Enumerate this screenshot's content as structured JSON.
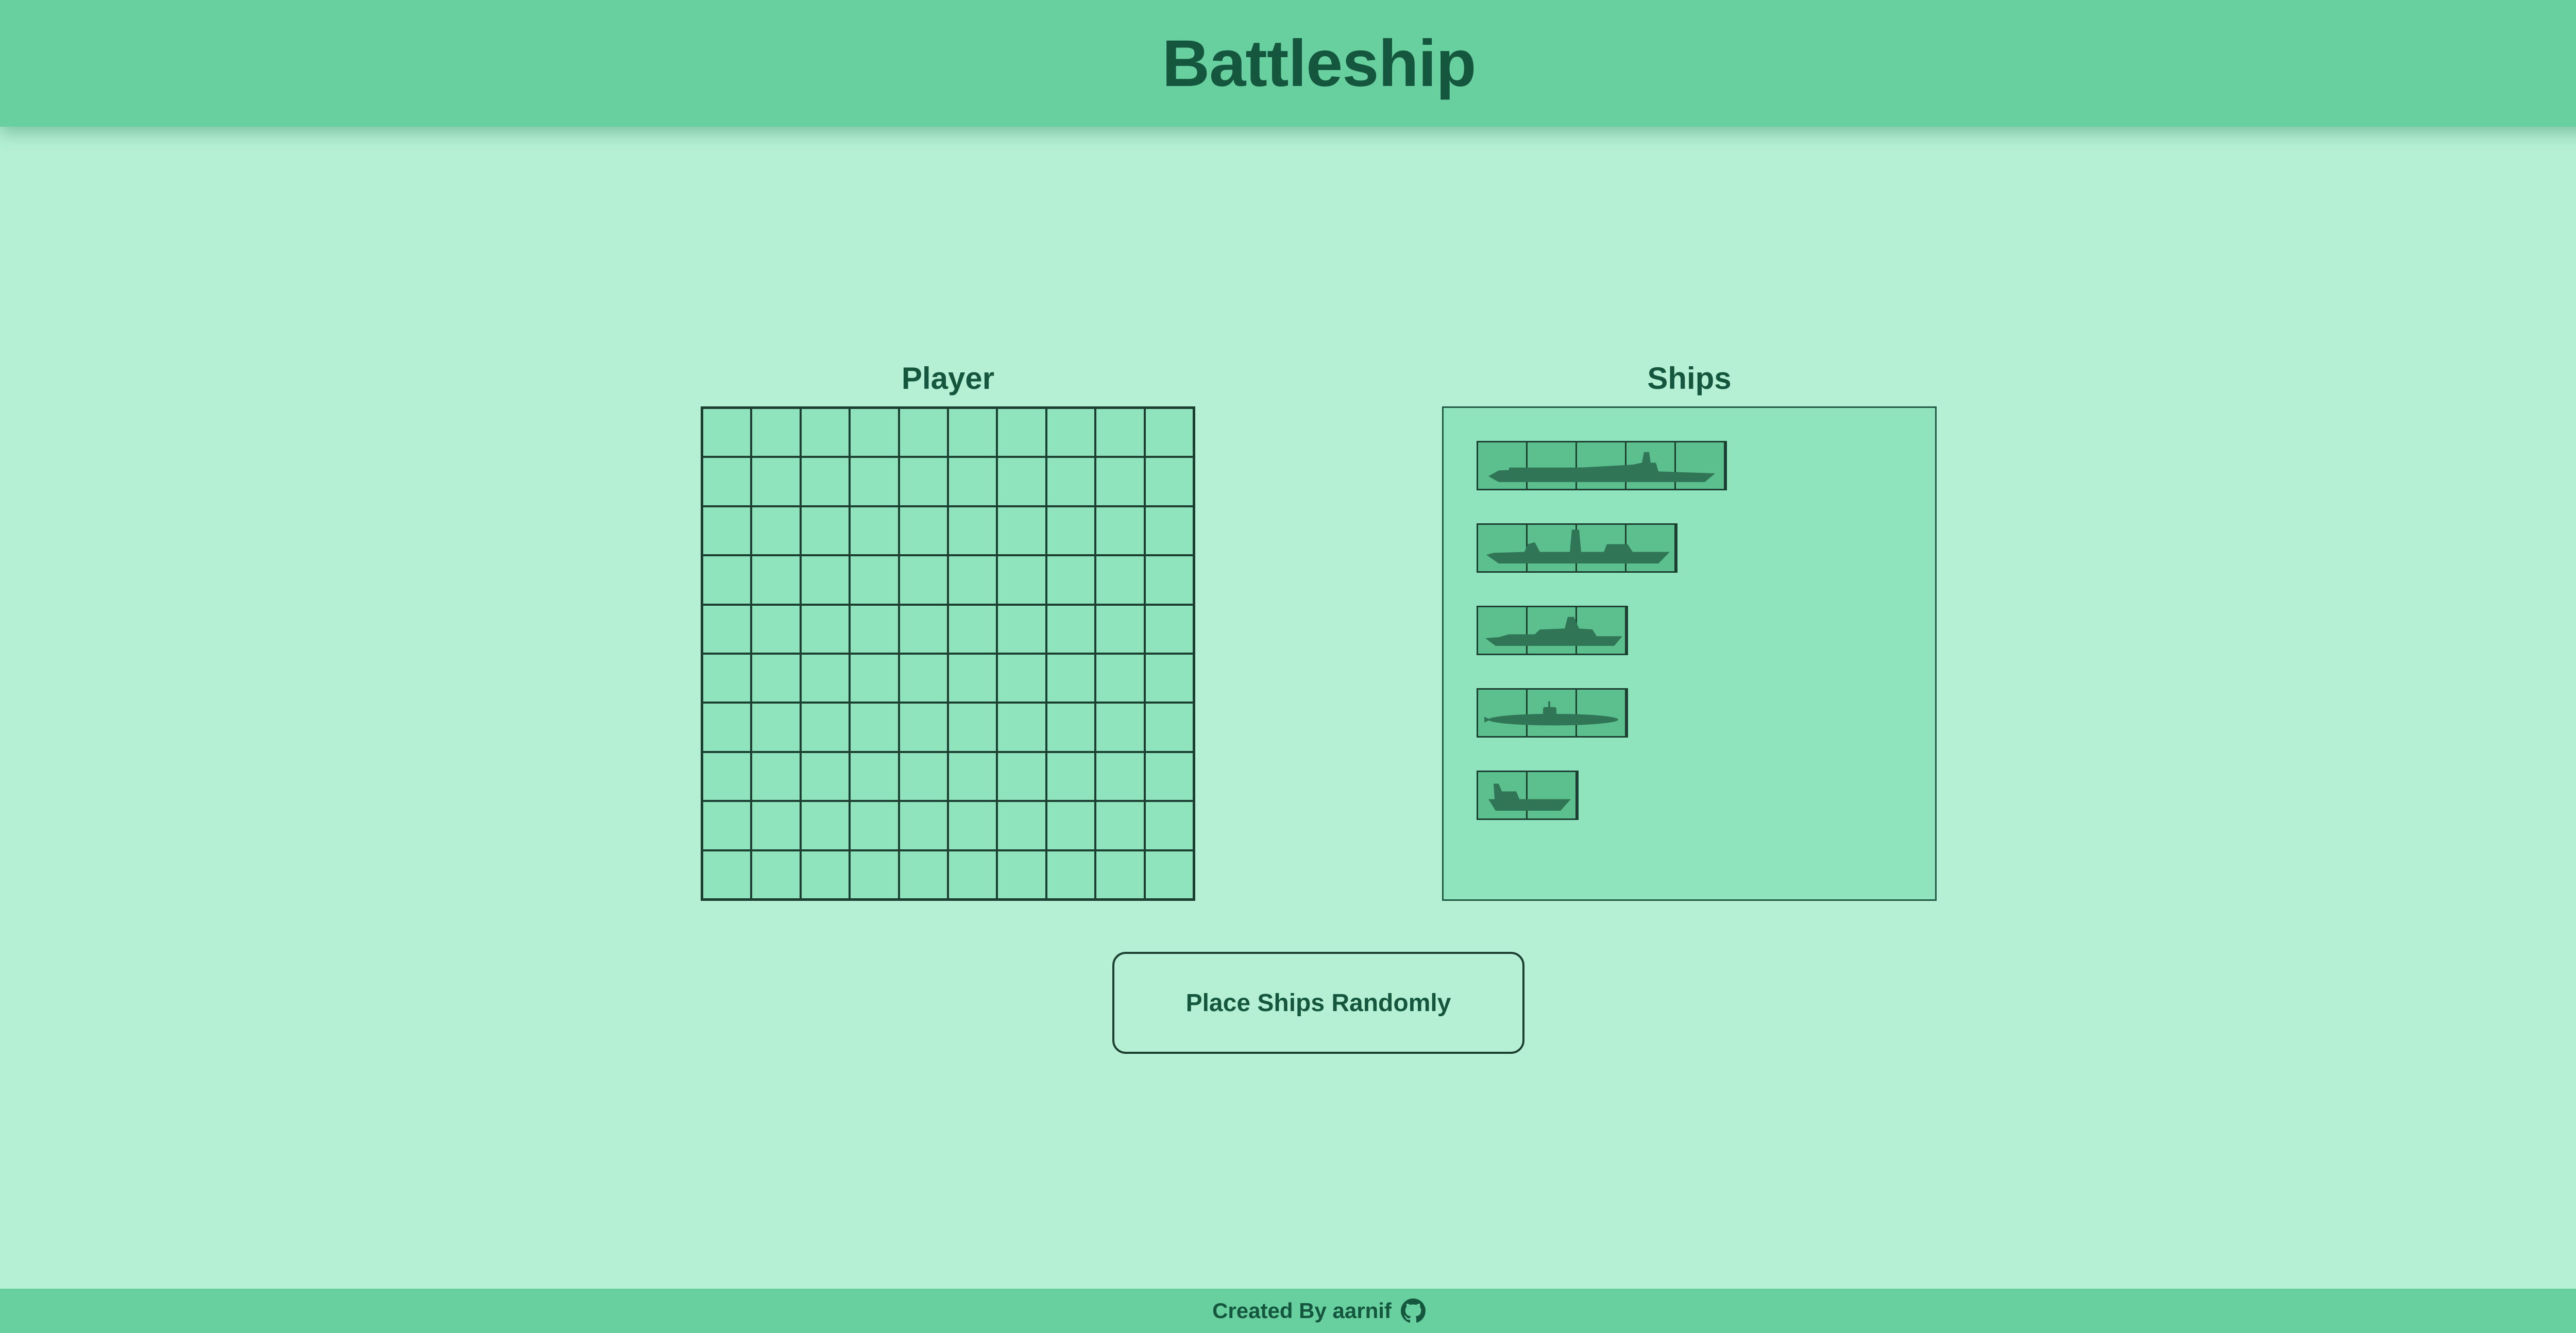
{
  "header": {
    "title": "Battleship"
  },
  "player_board": {
    "title": "Player",
    "rows": 10,
    "cols": 10
  },
  "ships_panel": {
    "title": "Ships",
    "ships": [
      {
        "name": "carrier",
        "length": 5,
        "icon": "aircraft-carrier-icon"
      },
      {
        "name": "battleship",
        "length": 4,
        "icon": "battleship-icon"
      },
      {
        "name": "destroyer",
        "length": 3,
        "icon": "destroyer-icon"
      },
      {
        "name": "submarine",
        "length": 3,
        "icon": "submarine-icon"
      },
      {
        "name": "patrol-boat",
        "length": 2,
        "icon": "patrol-boat-icon"
      }
    ]
  },
  "actions": {
    "place_randomly_label": "Place Ships Randomly"
  },
  "footer": {
    "credit": "Created By aarnif",
    "icon": "github-icon"
  },
  "colors": {
    "background": "#b5f0d4",
    "header": "#68d09e",
    "cell": "#8fe4bd",
    "ship": "#5bbf8e",
    "text": "#14563e",
    "border": "#1c3f31"
  }
}
